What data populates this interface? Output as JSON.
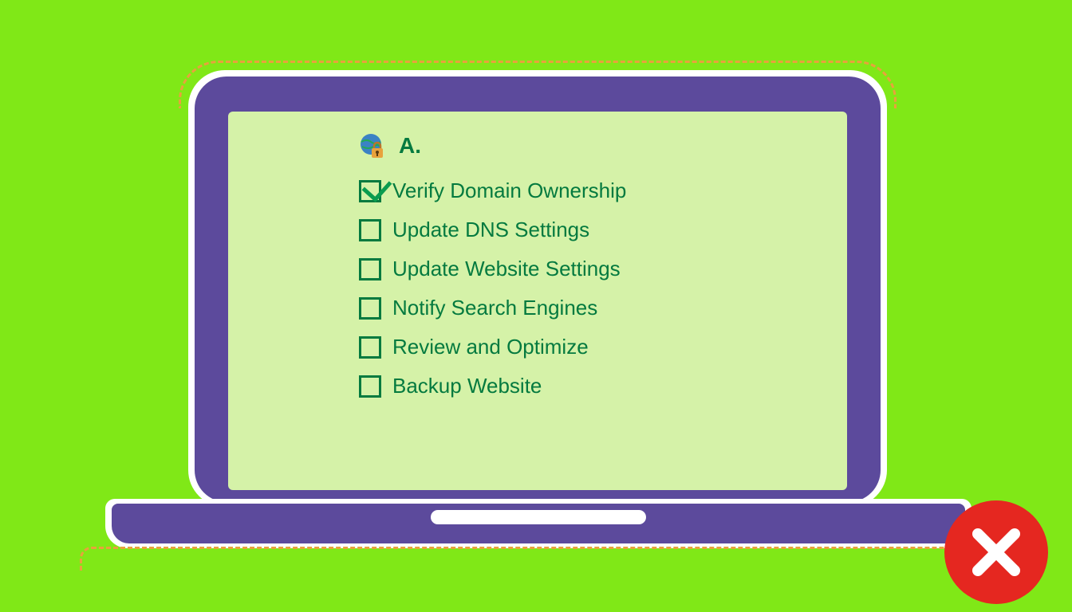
{
  "header": {
    "label": "A."
  },
  "checklist": [
    {
      "label": "Verify Domain Ownership",
      "checked": true
    },
    {
      "label": "Update DNS Settings",
      "checked": false
    },
    {
      "label": "Update Website Settings",
      "checked": false
    },
    {
      "label": "Notify Search Engines",
      "checked": false
    },
    {
      "label": "Review and Optimize",
      "checked": false
    },
    {
      "label": "Backup Website",
      "checked": false
    }
  ],
  "badge": {
    "type": "error"
  }
}
